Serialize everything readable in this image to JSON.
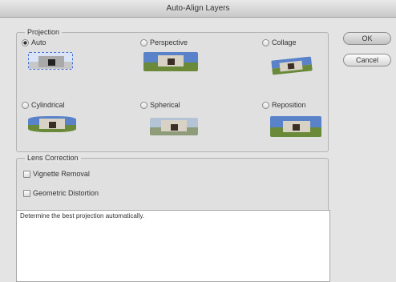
{
  "window": {
    "title": "Auto-Align Layers"
  },
  "projection": {
    "legend": "Projection",
    "options": [
      {
        "label": "Auto",
        "checked": true
      },
      {
        "label": "Perspective",
        "checked": false
      },
      {
        "label": "Collage",
        "checked": false
      },
      {
        "label": "Cylindrical",
        "checked": false
      },
      {
        "label": "Spherical",
        "checked": false
      },
      {
        "label": "Reposition",
        "checked": false
      }
    ]
  },
  "lens_correction": {
    "legend": "Lens Correction",
    "vignette_label": "Vignette Removal",
    "geometric_label": "Geometric Distortion"
  },
  "description": "Determine the best projection automatically.",
  "buttons": {
    "ok": "OK",
    "cancel": "Cancel"
  }
}
